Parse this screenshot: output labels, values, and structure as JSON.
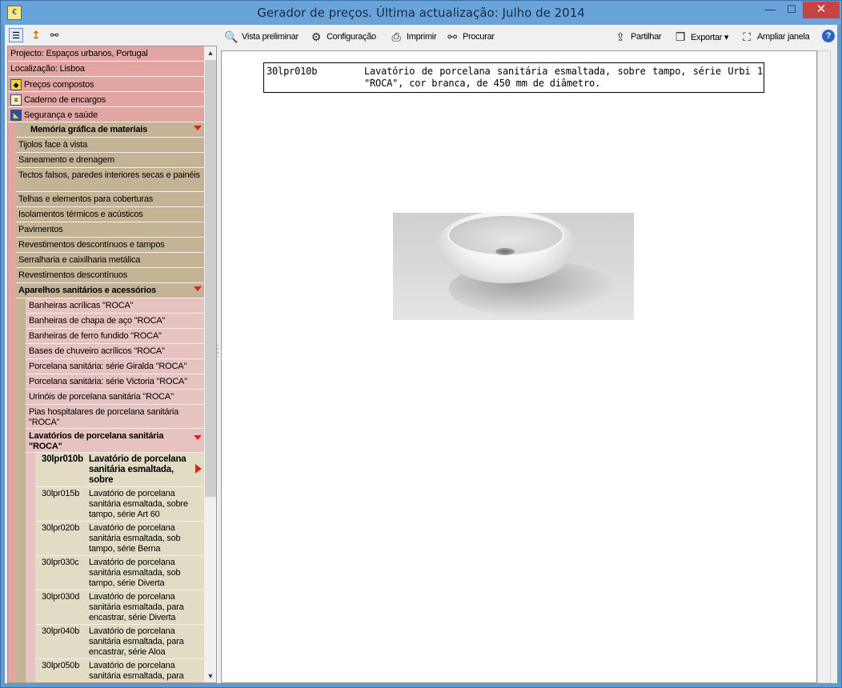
{
  "window": {
    "title": "Gerador de preços. Última actualização: Julho de 2014",
    "minimize": "—",
    "maximize": "☐",
    "close": "✕"
  },
  "left_toolbar": {
    "icons": [
      "list-view-icon",
      "folder-up-icon",
      "binoculars-icon"
    ]
  },
  "toolbar": {
    "preview_label": "Vista preliminar",
    "config_label": "Configuração",
    "print_label": "Imprimir",
    "search_label": "Procurar",
    "share_label": "Partilhar",
    "export_label": "Exportar ▾",
    "expand_label": "Ampliar janela",
    "help_label": "?"
  },
  "tree": {
    "top": [
      {
        "label": "Projecto: Espaços urbanos, Portugal"
      },
      {
        "label": "Localização: Lisboa"
      },
      {
        "label": "Preços compostos",
        "icon": "composite-prices-icon"
      },
      {
        "label": "Caderno de encargos",
        "icon": "specifications-icon"
      },
      {
        "label": "Segurança e saúde",
        "icon": "safety-icon"
      }
    ],
    "section": "Memória gráfica de materiais",
    "categories": [
      "Tijolos face à vista",
      "Saneamento e drenagem",
      "Tectos falsos, paredes interiores secas e painéis",
      "Telhas e elementos para coberturas",
      "Isolamentos térmicos e acústicos",
      "Pavimentos",
      "Revestimentos descontínuos e tampos",
      "Serralharia e caixilharia metálica",
      "Revestimentos descontínuos"
    ],
    "open_category": "Aparelhos sanitários e acessórios",
    "subcategories": [
      "Banheiras acrílicas \"ROCA\"",
      "Banheiras de chapa de aço \"ROCA\"",
      "Banheiras de ferro fundido \"ROCA\"",
      "Bases de chuveiro acrílicos \"ROCA\"",
      "Porcelana sanitária: série Giralda \"ROCA\"",
      "Porcelana sanitária: série Victoria \"ROCA\"",
      "Urinóis de porcelana sanitária \"ROCA\"",
      "Pias hospitalares de porcelana sanitária \"ROCA\""
    ],
    "open_subcategory": "Lavatórios de porcelana sanitária \"ROCA\"",
    "items": [
      {
        "code": "30lpr010b",
        "desc": "Lavatório de porcelana sanitária esmaltada, sobre",
        "selected": true
      },
      {
        "code": "30lpr015b",
        "desc": "Lavatório de porcelana sanitária esmaltada, sobre tampo, série Art 60"
      },
      {
        "code": "30lpr020b",
        "desc": "Lavatório de porcelana sanitária esmaltada, sob tampo, série Berna"
      },
      {
        "code": "30lpr030c",
        "desc": "Lavatório de porcelana sanitária esmaltada, sob tampo, série Diverta"
      },
      {
        "code": "30lpr030d",
        "desc": "Lavatório de porcelana sanitária esmaltada, para encastrar, série Diverta"
      },
      {
        "code": "30lpr040b",
        "desc": "Lavatório de porcelana sanitária esmaltada, para encastrar, série Aloa"
      },
      {
        "code": "30lpr050b",
        "desc": "Lavatório de porcelana sanitária esmaltada, para"
      }
    ]
  },
  "content": {
    "code": "30lpr010b",
    "description": "Lavatório de porcelana sanitária esmaltada, sobre tampo, série Urbi 1 \"ROCA\", cor branca, de 450 mm de diâmetro."
  },
  "colors": {
    "level0": "#e2a6a2",
    "level1": "#c4b395",
    "level2": "#e6c2c0",
    "level3": "#e2dcc5",
    "expand_arrow": "#e0201c",
    "titlebar": "#69a3dc"
  }
}
